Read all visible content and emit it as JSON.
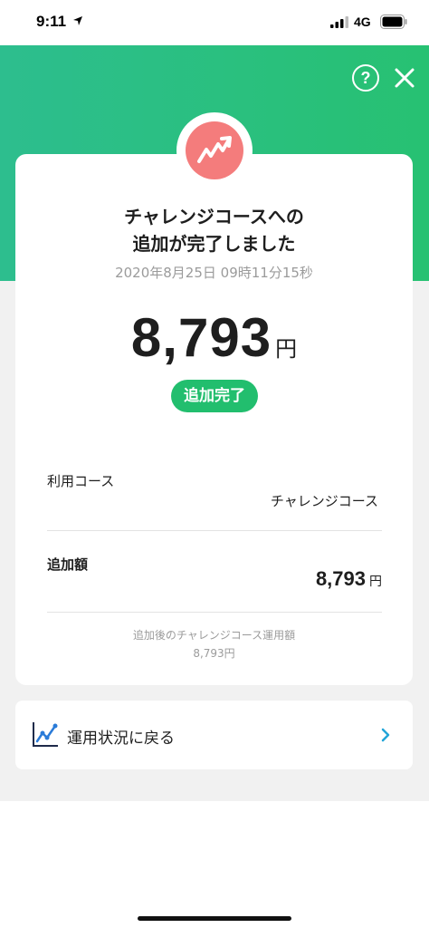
{
  "status_bar": {
    "time": "9:11",
    "network": "4G"
  },
  "header": {
    "help_label": "?"
  },
  "card": {
    "title_line1": "チャレンジコースへの",
    "title_line2": "追加が完了しました",
    "timestamp": "2020年8月25日 09時11分15秒",
    "amount": "8,793",
    "amount_unit": "円",
    "status_badge": "追加完了",
    "course_label": "利用コース",
    "course_value": "チャレンジコース",
    "add_label": "追加額",
    "add_value": "8,793",
    "add_unit": "円",
    "note_line1": "追加後のチャレンジコース運用額",
    "note_line2": "8,793円"
  },
  "nav": {
    "label": "運用状況に戻る",
    "accent": "#22a5d8"
  },
  "colors": {
    "hero_green": "#27c172",
    "badge_green": "#22be6e",
    "avatar_pink": "#f47c7c"
  }
}
